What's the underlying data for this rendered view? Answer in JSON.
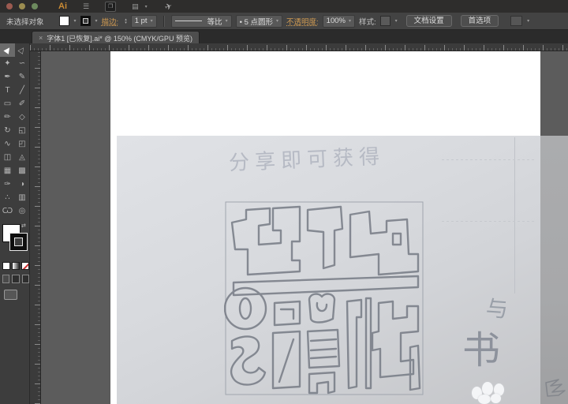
{
  "window": {
    "logo": "Ai",
    "traffic_lights": [
      "close",
      "minimize",
      "fullscreen"
    ]
  },
  "icons": {
    "dropdown": "▾",
    "stepper_up": "▴",
    "stepper_down": "▾",
    "tab_close": "×",
    "menu_grid": "☰",
    "arrange_documents": "❐",
    "workspace_switcher": "▤",
    "share": "✈",
    "swap_fill_stroke": "⇄"
  },
  "control_bar": {
    "selection_status": "未选择对象",
    "stroke_label": "描边:",
    "stroke_weight": "1 pt",
    "width_profile": "等比",
    "brush": "• 5 点圆形",
    "opacity_label": "不透明度:",
    "opacity_value": "100%",
    "style_label": "样式:",
    "document_setup_label": "文档设置",
    "preferences_label": "首选项"
  },
  "tab": {
    "title": "字体1 [已恢复].ai* @ 150% (CMYK/GPU 预览)"
  },
  "tools": [
    {
      "name": "selection",
      "glyph": "▶"
    },
    {
      "name": "direct-selection",
      "glyph": "▷"
    },
    {
      "name": "magic-wand",
      "glyph": "✦"
    },
    {
      "name": "lasso",
      "glyph": "∽"
    },
    {
      "name": "pen",
      "glyph": "✒"
    },
    {
      "name": "curvature",
      "glyph": "✎"
    },
    {
      "name": "type",
      "glyph": "T"
    },
    {
      "name": "line-segment",
      "glyph": "╱"
    },
    {
      "name": "rectangle",
      "glyph": "▭"
    },
    {
      "name": "paintbrush",
      "glyph": "✐"
    },
    {
      "name": "pencil",
      "glyph": "✏"
    },
    {
      "name": "shaper",
      "glyph": "◇"
    },
    {
      "name": "rotate",
      "glyph": "↻"
    },
    {
      "name": "scale",
      "glyph": "◱"
    },
    {
      "name": "width",
      "glyph": "∿"
    },
    {
      "name": "free-transform",
      "glyph": "◰"
    },
    {
      "name": "shape-builder",
      "glyph": "◫"
    },
    {
      "name": "perspective-grid",
      "glyph": "◬"
    },
    {
      "name": "mesh",
      "glyph": "▦"
    },
    {
      "name": "gradient",
      "glyph": "▩"
    },
    {
      "name": "eyedropper",
      "glyph": "✑"
    },
    {
      "name": "blend",
      "glyph": "◑"
    },
    {
      "name": "symbol-sprayer",
      "glyph": "∴"
    },
    {
      "name": "column-graph",
      "glyph": "▥"
    },
    {
      "name": "hand",
      "glyph": "Ѡ"
    },
    {
      "name": "zoom",
      "glyph": "◎"
    }
  ],
  "canvas": {
    "sketch_caption": "分享即可获得",
    "annotation_char_top": "与",
    "annotation_char_bottom": "书"
  },
  "colors": {
    "accent_amber_link": "#cf9a52",
    "ai_logo_orange": "#c98a34",
    "pasteboard_gray": "#5c5c5c",
    "artboard_white": "#ffffff",
    "photo_paper": "#d8dade",
    "photo_over_pasteboard": "#a7a8aa",
    "pencil_stroke": "#7d828c"
  }
}
